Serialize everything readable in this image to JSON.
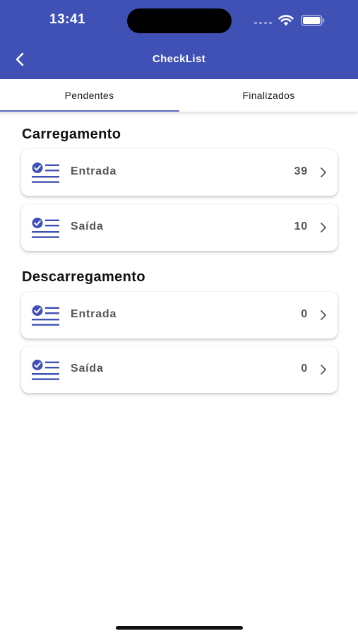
{
  "status_bar": {
    "time": "13:41"
  },
  "nav": {
    "title": "CheckList"
  },
  "tabs": [
    {
      "label": "Pendentes",
      "active": true
    },
    {
      "label": "Finalizados",
      "active": false
    }
  ],
  "sections": [
    {
      "title": "Carregamento",
      "items": [
        {
          "label": "Entrada",
          "count": "39",
          "icon": "checklist-icon"
        },
        {
          "label": "Saída",
          "count": "10",
          "icon": "checklist-icon"
        }
      ]
    },
    {
      "title": "Descarregamento",
      "items": [
        {
          "label": "Entrada",
          "count": "0",
          "icon": "checklist-icon"
        },
        {
          "label": "Saída",
          "count": "0",
          "icon": "checklist-icon"
        }
      ]
    }
  ],
  "colors": {
    "primary": "#3f51b5",
    "accent": "#5c6bc0",
    "icon": "#3f51b5"
  }
}
